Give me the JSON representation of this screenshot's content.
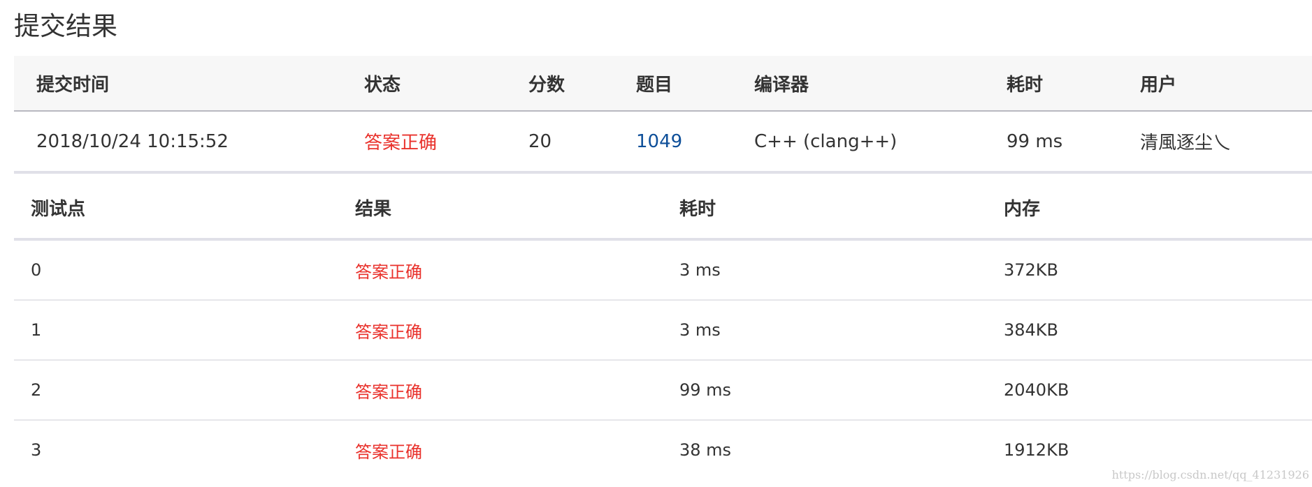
{
  "page": {
    "title": "提交结果"
  },
  "submission": {
    "headers": {
      "time": "提交时间",
      "status": "状态",
      "score": "分数",
      "problem": "题目",
      "compiler": "编译器",
      "elapsed": "耗时",
      "user": "用户"
    },
    "row": {
      "time": "2018/10/24 10:15:52",
      "status": "答案正确",
      "score": "20",
      "problem": "1049",
      "compiler": "C++ (clang++)",
      "elapsed": "99 ms",
      "user": "清風逐尘乀"
    }
  },
  "cases": {
    "headers": {
      "case": "测试点",
      "result": "结果",
      "elapsed": "耗时",
      "memory": "内存"
    },
    "rows": [
      {
        "case": "0",
        "result": "答案正确",
        "elapsed": "3 ms",
        "memory": "372KB"
      },
      {
        "case": "1",
        "result": "答案正确",
        "elapsed": "3 ms",
        "memory": "384KB"
      },
      {
        "case": "2",
        "result": "答案正确",
        "elapsed": "99 ms",
        "memory": "2040KB"
      },
      {
        "case": "3",
        "result": "答案正确",
        "elapsed": "38 ms",
        "memory": "1912KB"
      }
    ]
  },
  "watermark": {
    "text": "https://blog.csdn.net/qq_41231926"
  },
  "colors": {
    "accepted": "#e9322c",
    "link": "#0e4f99",
    "header_bg": "#f7f7f7"
  }
}
